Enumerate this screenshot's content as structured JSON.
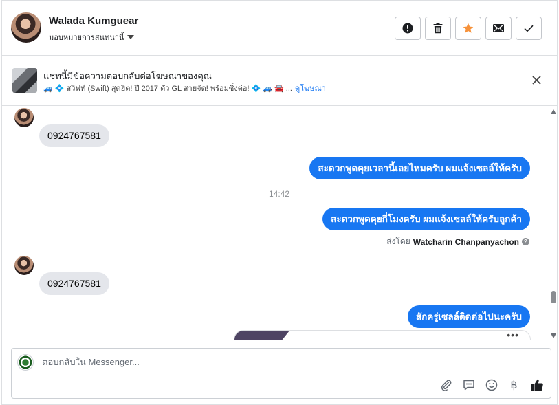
{
  "header": {
    "name": "Walada Kumguear",
    "assign_label": "มอบหมายการสนทนานี้",
    "actions": [
      {
        "icon": "alert-icon",
        "label": "Mark as spam"
      },
      {
        "icon": "trash-icon",
        "label": "Delete"
      },
      {
        "icon": "star-icon",
        "label": "Star"
      },
      {
        "icon": "envelope-icon",
        "label": "Mark unread"
      },
      {
        "icon": "check-icon",
        "label": "Done"
      }
    ]
  },
  "ad_banner": {
    "title": "แชทนี้มีข้อความตอบกลับต่อโฆษณาของคุณ",
    "subtitle": "🚙 💠 สวิฟท์ (Swift) สุดฮิต! ปี 2017 ตัว GL สายจัด! พร้อมซิ่งต่อ! 💠 🚙 🚘 ...",
    "link": "ดูโฆษณา"
  },
  "thread": {
    "messages": [
      {
        "dir": "in",
        "text": "0924767581"
      },
      {
        "dir": "out",
        "text": "สะดวกพูดคุยเวลานี้เลยไหมครับ ผมแจ้งเซลล์ให้ครับ"
      },
      {
        "dir": "time",
        "text": "14:42"
      },
      {
        "dir": "out",
        "text": "สะดวกพูดคุยกี่โมงครับ ผมแจ้งเซลล์ให้ครับลูกค้า"
      },
      {
        "dir": "in",
        "text": "0924767581"
      },
      {
        "dir": "out",
        "text": "สักครู่เซลล์ติดต่อไปนะครับ"
      }
    ],
    "sent_by_prefix": "ส่งโดย",
    "sent_by_name": "Watcharin Chanpanyachon",
    "card_menu": "•••"
  },
  "composer": {
    "placeholder": "ตอบกลับใน Messenger...",
    "tools": [
      "paperclip-icon",
      "chat-bubble-icon",
      "smiley-icon",
      "baht-icon",
      "thumbs-up-icon"
    ],
    "baht_symbol": "฿"
  },
  "colors": {
    "accent": "#1877f2",
    "star": "#f7923a",
    "incoming_bubble": "#e4e6eb"
  }
}
